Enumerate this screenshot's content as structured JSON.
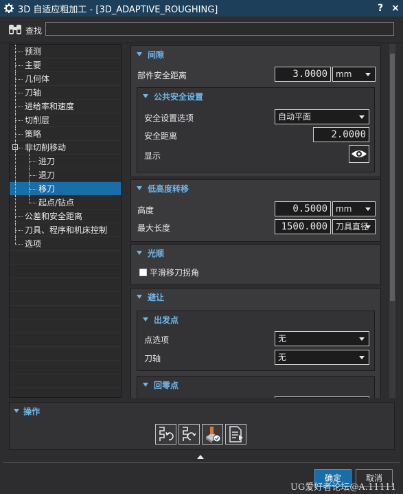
{
  "window": {
    "title": "3D 自适应粗加工 - [3D_ADAPTIVE_ROUGHING]",
    "help_label": "?",
    "close_label": "×",
    "icon": "gear-icon"
  },
  "search": {
    "label": "查找",
    "value": "",
    "icon": "binoculars-icon"
  },
  "tree": {
    "items": [
      {
        "label": "预测",
        "level": 0
      },
      {
        "label": "主要",
        "level": 0
      },
      {
        "label": "几何体",
        "level": 0
      },
      {
        "label": "刀轴",
        "level": 0
      },
      {
        "label": "进给率和速度",
        "level": 0
      },
      {
        "label": "切削层",
        "level": 0
      },
      {
        "label": "策略",
        "level": 0
      },
      {
        "label": "非切削移动",
        "level": 0,
        "expanded": true
      },
      {
        "label": "进刀",
        "level": 1
      },
      {
        "label": "退刀",
        "level": 1
      },
      {
        "label": "移刀",
        "level": 1,
        "selected": true
      },
      {
        "label": "起点/钻点",
        "level": 1
      },
      {
        "label": "公差和安全距离",
        "level": 0
      },
      {
        "label": "刀具、程序和机床控制",
        "level": 0
      },
      {
        "label": "选项",
        "level": 0
      }
    ]
  },
  "clearance": {
    "title": "间隙",
    "part_safe_distance_label": "部件安全距离",
    "part_safe_distance_value": "3.0000",
    "part_safe_distance_unit": "mm",
    "common_settings": {
      "title": "公共安全设置",
      "option_label": "安全设置选项",
      "option_value": "自动平面",
      "safe_distance_label": "安全距离",
      "safe_distance_value": "2.0000",
      "display_label": "显示",
      "display_icon": "eye-icon"
    }
  },
  "low_transfer": {
    "title": "低高度转移",
    "height_label": "高度",
    "height_value": "0.5000",
    "height_unit": "mm",
    "max_length_label": "最大长度",
    "max_length_value": "1500.000",
    "max_length_unit": "刀具直径"
  },
  "smooth": {
    "title": "光顺",
    "smooth_corners_label": "平滑移刀拐角",
    "smooth_corners_checked": false
  },
  "avoidance": {
    "title": "避让",
    "from_point": {
      "title": "出发点",
      "point_option_label": "点选项",
      "point_option_value": "无",
      "tool_axis_label": "刀轴",
      "tool_axis_value": "无"
    },
    "return_point": {
      "title": "回零点"
    }
  },
  "operations": {
    "title": "操作",
    "buttons": [
      "generate-icon",
      "replay-icon",
      "verify-icon",
      "list-icon"
    ]
  },
  "footer": {
    "ok_label": "确定",
    "cancel_label": "取消",
    "watermark": "UG爱好者论坛@A.11111"
  },
  "colors": {
    "titlebar": "#1e3f5a",
    "accent": "#6fb6e8",
    "selection": "#1a6ea8"
  }
}
